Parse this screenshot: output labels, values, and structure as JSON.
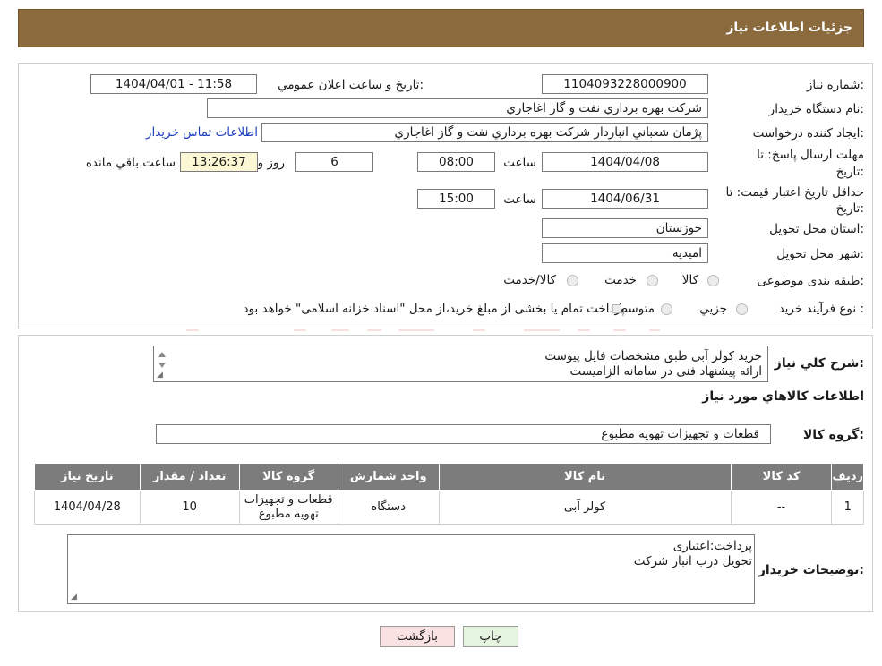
{
  "header": {
    "title": "جزئیات اطلاعات نیاز"
  },
  "form": {
    "need_number_label": "شماره نیاز:",
    "need_number": "1104093228000900",
    "announce_label": "تاریخ و ساعت اعلان عمومي:",
    "announce_value": "1404/04/01 - 11:58",
    "buyer_org_label": "نام دستگاه خریدار:",
    "buyer_org": "شركت بهره برداري نفت و گاز اغاجاري",
    "creator_label": "ایجاد کننده درخواست:",
    "creator": "پژمان شعباني انباردار شركت بهره برداري نفت و گاز اغاجاري",
    "contact_link": "اطلاعات تماس خریدار",
    "deadline_label_1": "مهلت ارسال پاسخ: تا",
    "deadline_label_2": "تاریخ:",
    "deadline_date": "1404/04/08",
    "time_label": "ساعت",
    "deadline_time": "08:00",
    "days_value": "6",
    "days_label": "روز و",
    "remaining_time": "13:26:37",
    "remaining_label": "ساعت باقي مانده",
    "validity_label_1": "حداقل تاریخ اعتبار قیمت: تا",
    "validity_label_2": "تاریخ:",
    "validity_date": "1404/06/31",
    "validity_time": "15:00",
    "province_label": "استان محل تحویل:",
    "province": "خوزستان",
    "city_label": "شهر محل تحویل:",
    "city": "امیدیه",
    "category_label": "طبقه بندی موضوعی:",
    "category_options": [
      "کالا",
      "خدمت",
      "کالا/خدمت"
    ],
    "process_label": "نوع فرآیند خرید :",
    "process_options": [
      "جزیي",
      "متوسط"
    ],
    "process_note": "پرداخت تمام یا بخشی از مبلغ خرید،از محل \"اسناد خزانه اسلامی\" خواهد بود."
  },
  "details": {
    "summary_label": "شرح كلي نياز:",
    "summary_lines": [
      "خرید کولر آبی طبق مشخصات فایل پیوست",
      "ارائه پیشنهاد فنی در سامانه الزامیست"
    ],
    "goods_info_title": "اطلاعات كالاهاي مورد نياز",
    "goods_group_label": "گروه كالا:",
    "goods_group": "قطعات و تجهیزات تهویه مطبوع",
    "table": {
      "headers": [
        "رديف",
        "كد كالا",
        "نام كالا",
        "واحد شمارش",
        "گروه كالا",
        "تعداد / مقدار",
        "تاريخ نياز"
      ],
      "rows": [
        [
          "1",
          "--",
          "کولر آبی",
          "دستگاه",
          "قطعات و تجهیزات تهویه مطبوع",
          "10",
          "1404/04/28"
        ]
      ]
    },
    "buyer_notes_label": "توضيحات خريدار:",
    "buyer_notes_lines": [
      "پرداخت:اعتباری",
      "تحویل درب انبار شرکت"
    ]
  },
  "buttons": {
    "print": "چاپ",
    "back": "بازگشت"
  },
  "colors": {
    "header": "#8b6a3e",
    "table_header": "#7c7c7c",
    "link": "#1f3fbf"
  }
}
